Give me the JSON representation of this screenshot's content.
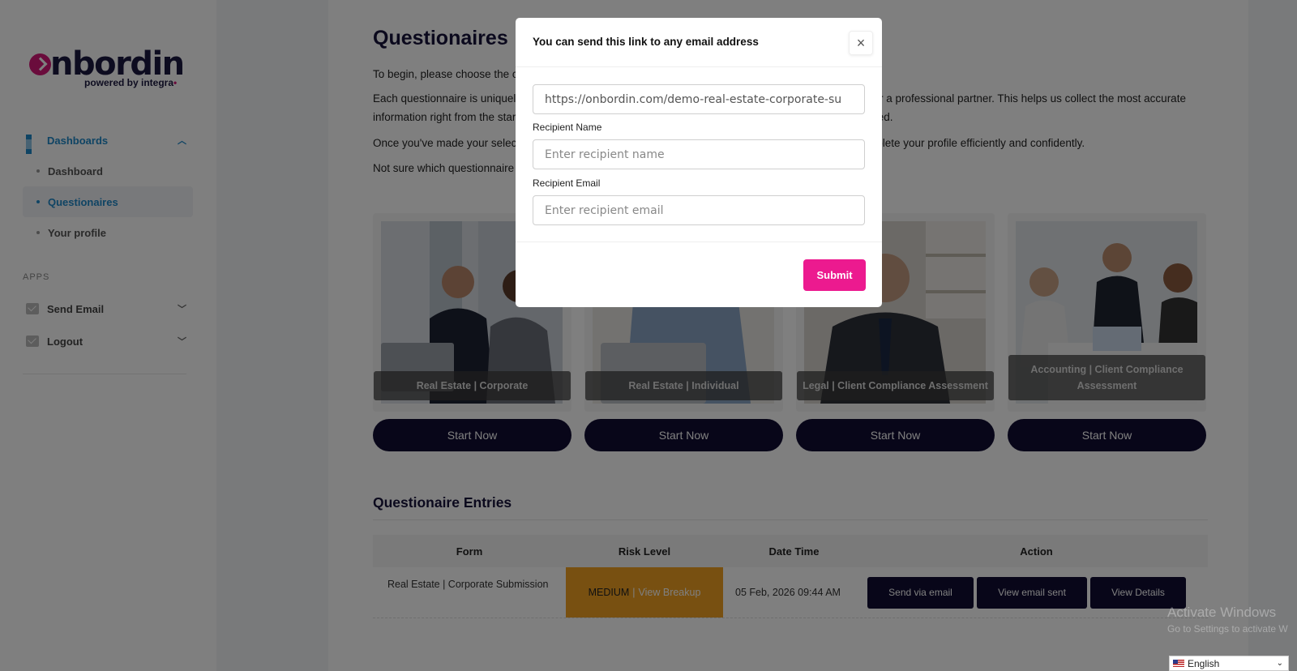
{
  "brand": {
    "word": "nbordin",
    "sub": "powered by integra"
  },
  "sidebar": {
    "dashboards_label": "Dashboards",
    "items": [
      {
        "label": "Dashboard"
      },
      {
        "label": "Questionaires"
      },
      {
        "label": "Your profile"
      }
    ],
    "apps_title": "APPS",
    "send_email_label": "Send Email",
    "logout_label": "Logout"
  },
  "main": {
    "title": "Questionaires",
    "paragraphs": [
      "To begin, please choose the c",
      "Each questionnaire is uniquel",
      ", or a professional partner. This helps us collect the most accurate",
      "information right from the star",
      "lized.",
      "Once you've made your selec",
      "mplete your profile efficiently and confidently.",
      "Not sure which questionnaire"
    ],
    "cards": [
      {
        "label": "Real Estate | Corporate",
        "button": "Start Now"
      },
      {
        "label": "Real Estate | Individual",
        "button": "Start Now"
      },
      {
        "label": "Legal | Client Compliance Assessment",
        "button": "Start Now"
      },
      {
        "label": "Accounting | Client Compliance Assessment",
        "button": "Start Now"
      }
    ],
    "entries_title": "Questionaire Entries",
    "table": {
      "headers": [
        "Form",
        "Risk Level",
        "Date Time",
        "Action"
      ],
      "row": {
        "form": "Real Estate | Corporate Submission",
        "risk": "MEDIUM",
        "risk_sep": "|",
        "risk_link": "View Breakup",
        "datetime": "05 Feb, 2026 09:44 AM",
        "actions": [
          "Send via email",
          "View email sent",
          "View Details"
        ]
      }
    }
  },
  "modal": {
    "title": "You can send this link to any email address",
    "close_glyph": "×",
    "link_value": "https://onbordin.com/demo-real-estate-corporate-su",
    "name_label": "Recipient Name",
    "name_placeholder": "Enter recipient name",
    "email_label": "Recipient Email",
    "email_placeholder": "Enter recipient email",
    "submit_label": "Submit"
  },
  "os": {
    "watermark_line1": "Activate Windows",
    "watermark_line2": "Go to Settings to activate W",
    "language": "English"
  },
  "colors": {
    "accent": "#1e88c8",
    "brand": "#d41978",
    "submit": "#ec1a8f",
    "dark_button": "#100d33",
    "risk_medium": "#f0a023"
  }
}
